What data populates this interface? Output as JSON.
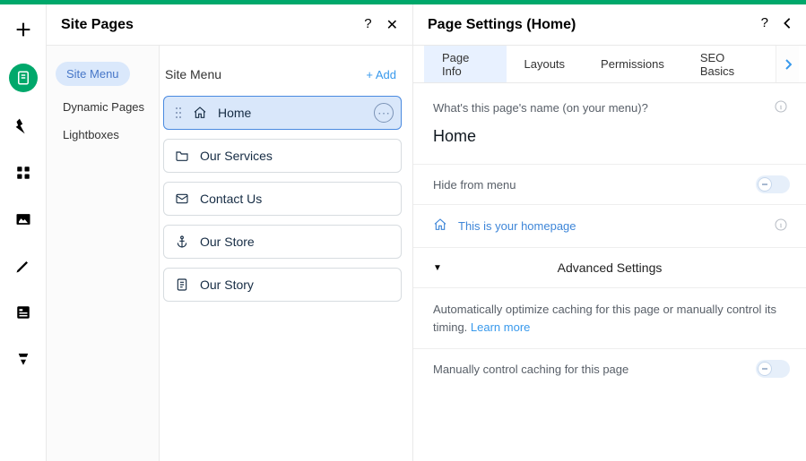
{
  "rail": [
    "plus",
    "pages",
    "design",
    "apps",
    "media",
    "pen",
    "box",
    "lang"
  ],
  "sitePages": {
    "title": "Site Pages",
    "nav": {
      "siteMenu": "Site Menu",
      "dynamic": "Dynamic Pages",
      "lightboxes": "Lightboxes"
    }
  },
  "menuList": {
    "title": "Site Menu",
    "addLabel": "+ Add",
    "items": [
      {
        "icon": "home",
        "label": "Home",
        "selected": true
      },
      {
        "icon": "folder",
        "label": "Our Services"
      },
      {
        "icon": "mail",
        "label": "Contact Us"
      },
      {
        "icon": "anchor",
        "label": "Our Store"
      },
      {
        "icon": "doc",
        "label": "Our Story"
      }
    ]
  },
  "settings": {
    "title": "Page Settings (Home)",
    "tabs": [
      "Page Info",
      "Layouts",
      "Permissions",
      "SEO Basics"
    ],
    "nameQuestion": "What's this page's name (on your menu)?",
    "nameValue": "Home",
    "hideLabel": "Hide from menu",
    "homepageLabel": "This is your homepage",
    "advanced": "Advanced Settings",
    "cacheDesc": "Automatically optimize caching for this page or manually control its timing. ",
    "learnMore": "Learn more",
    "manualCache": "Manually control caching for this page"
  }
}
